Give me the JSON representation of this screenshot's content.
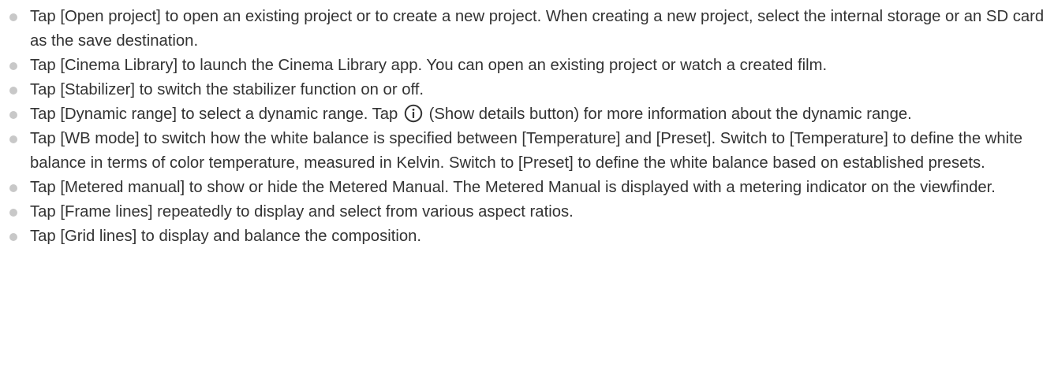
{
  "items": [
    {
      "text": "Tap [Open project] to open an existing project or to create a new project. When creating a new project, select the internal storage or an SD card as the save destination."
    },
    {
      "text": "Tap [Cinema Library] to launch the Cinema Library app. You can open an existing project or watch a created film."
    },
    {
      "text": "Tap [Stabilizer] to switch the stabilizer function on or off."
    },
    {
      "text_before": "Tap [Dynamic range] to select a dynamic range. Tap",
      "icon": "info-circle-icon",
      "text_after": "(Show details button) for more information about the dynamic range."
    },
    {
      "text": "Tap [WB mode] to switch how the white balance is specified between [Temperature] and [Preset]. Switch to [Temperature] to define the white balance in terms of color temperature, measured in Kelvin. Switch to [Preset] to define the white balance based on established presets."
    },
    {
      "text": "Tap [Metered manual] to show or hide the Metered Manual. The Metered Manual is displayed with a metering indicator on the viewfinder."
    },
    {
      "text": "Tap [Frame lines] repeatedly to display and select from various aspect ratios."
    },
    {
      "text": "Tap [Grid lines] to display and balance the composition."
    }
  ],
  "colors": {
    "text": "#333333",
    "bullet": "#c8c8c8"
  }
}
